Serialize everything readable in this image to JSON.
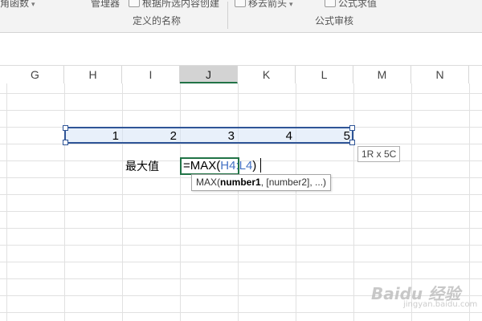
{
  "ribbon": {
    "cut_items": [
      {
        "label": "角函数",
        "icon": "function-icon",
        "has_dropdown": true
      },
      {
        "label": "管理器",
        "icon": "name-manager-icon",
        "has_dropdown": false
      },
      {
        "label": "根据所选内容创建",
        "icon": "create-from-selection-icon",
        "has_dropdown": false
      },
      {
        "label": "移去箭头",
        "icon": "remove-arrows-icon",
        "has_dropdown": true
      },
      {
        "label": "公式求值",
        "icon": "evaluate-formula-icon",
        "has_dropdown": false
      }
    ],
    "groups": {
      "defined_names": "定义的名称",
      "formula_auditing": "公式审核"
    }
  },
  "sheet": {
    "columns": [
      "G",
      "H",
      "I",
      "J",
      "K",
      "L",
      "M",
      "N"
    ],
    "active_column": "J",
    "data_row": {
      "values": [
        "1",
        "2",
        "3",
        "4",
        "5"
      ]
    },
    "label": "最大值",
    "formula": {
      "prefix": "=MAX(",
      "range_ref": "H4:L4",
      "suffix": ")"
    },
    "tooltip": {
      "fn": "MAX(",
      "arg1": "number1",
      "rest": ", [number2], ...)"
    },
    "selection_size": "1R x 5C"
  },
  "colors": {
    "selection_border": "#2f5597",
    "edit_border": "#217346",
    "ref_text": "#4472c4"
  },
  "watermark": {
    "text": "Baidu 经验",
    "sub": "jingyan.baidu.com"
  }
}
